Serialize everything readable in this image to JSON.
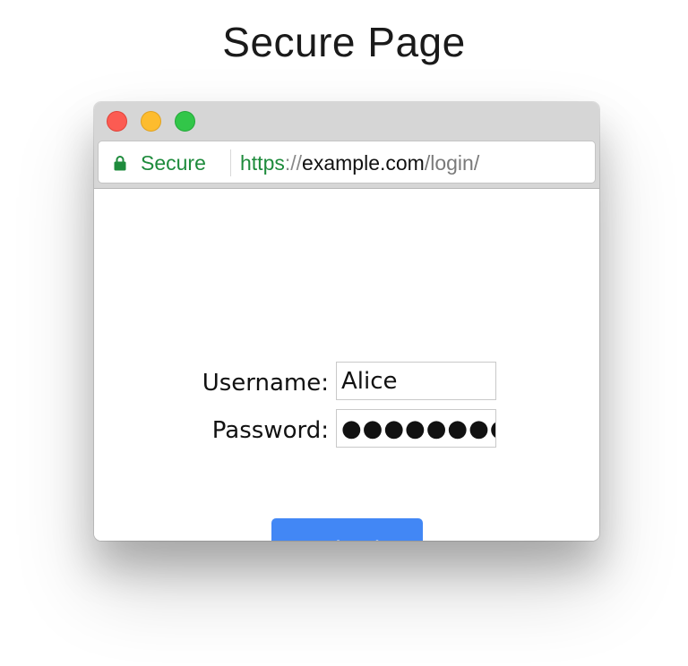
{
  "page": {
    "title": "Secure Page"
  },
  "browser": {
    "traffic_lights": {
      "close_color": "#fc5b52",
      "minimize_color": "#fdbc2e",
      "maximize_color": "#32c649"
    },
    "address_bar": {
      "lock_icon": "lock-icon",
      "secure_label": "Secure",
      "url_scheme": "https",
      "url_separator": "://",
      "url_host": "example.com",
      "url_path": "/login/",
      "secure_color": "#1e8b3c"
    }
  },
  "form": {
    "username_label": "Username:",
    "username_value": "Alice",
    "password_label": "Password:",
    "password_value": "●●●●●●●●",
    "submit_label": "Submit",
    "submit_color": "#4287f5"
  }
}
